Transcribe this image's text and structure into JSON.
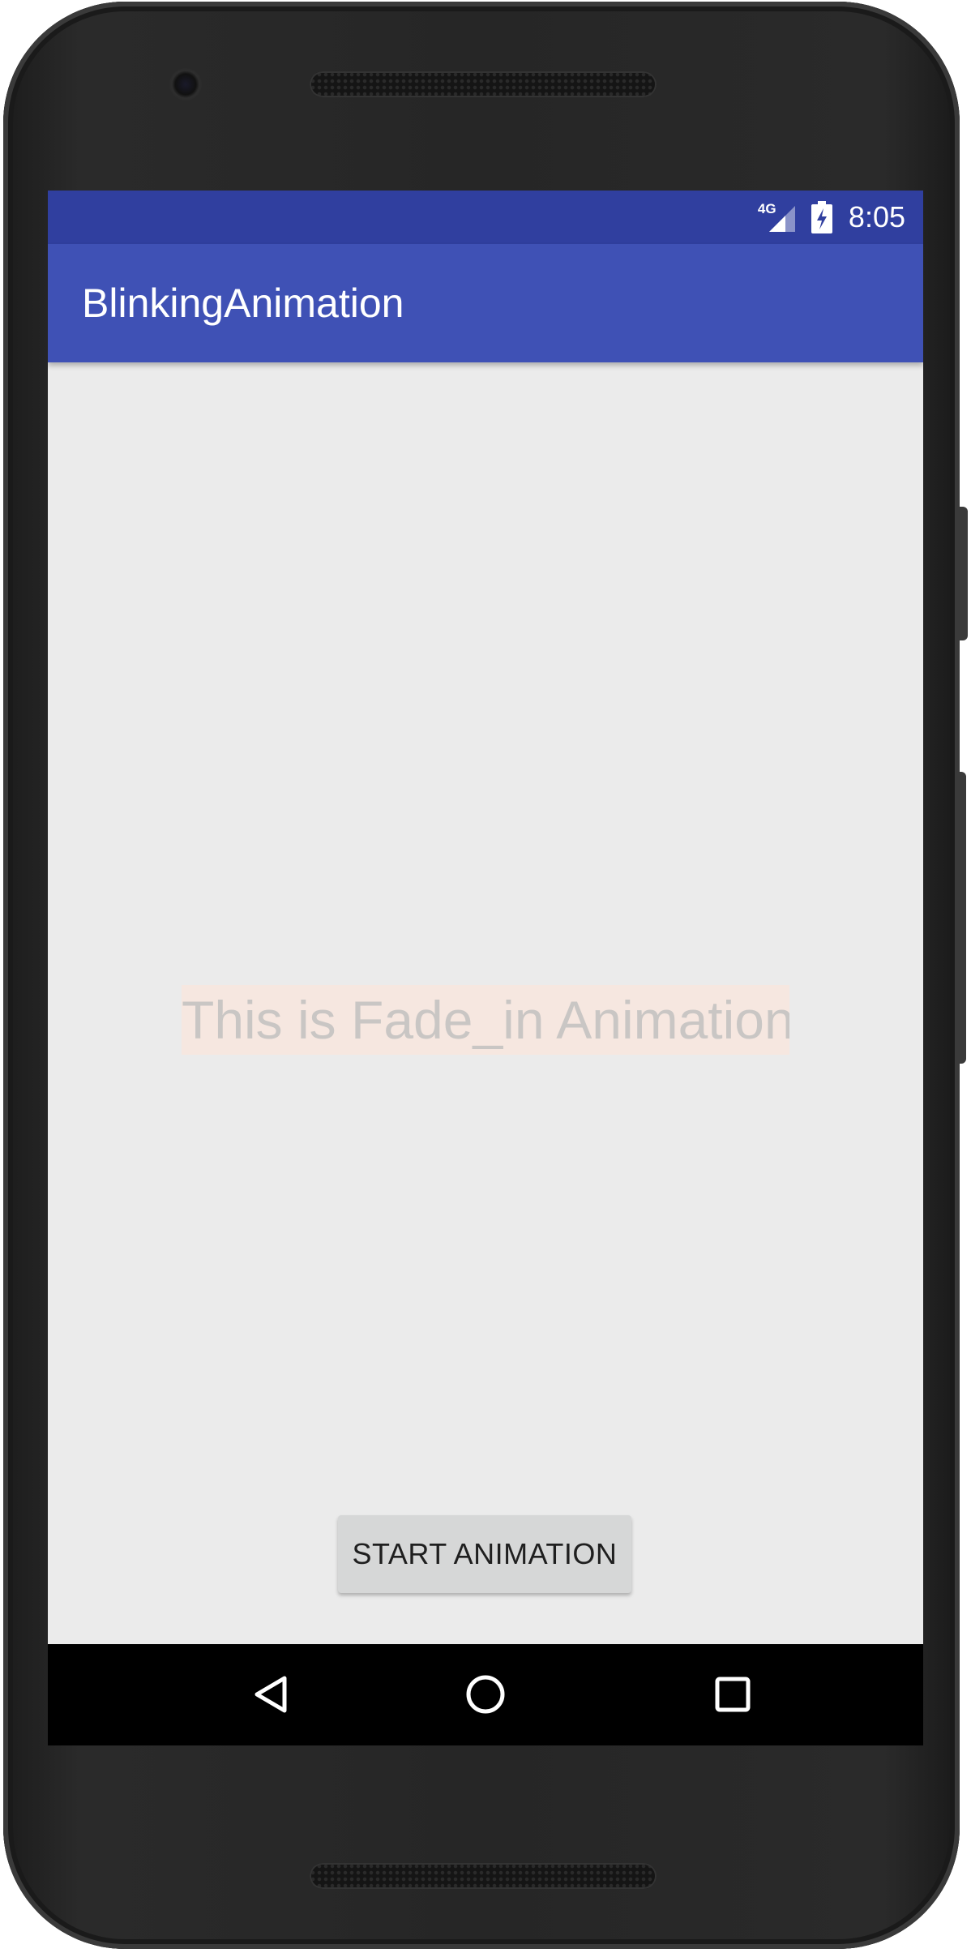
{
  "status_bar": {
    "network_type": "4G",
    "time": "8:05",
    "icons": [
      "signal-4g-icon",
      "battery-charging-icon"
    ]
  },
  "app_bar": {
    "title": "BlinkingAnimation"
  },
  "main": {
    "animated_text": "This is Fade_in Animation",
    "start_button_label": "START ANIMATION"
  },
  "nav_bar": {
    "icons": [
      "back-icon",
      "home-icon",
      "recents-icon"
    ]
  },
  "colors": {
    "status_bar": "#303f9f",
    "app_bar": "#3f51b5",
    "background": "#ebebeb",
    "button": "#d6d7d7",
    "text_highlight": "#fbe4d7"
  }
}
